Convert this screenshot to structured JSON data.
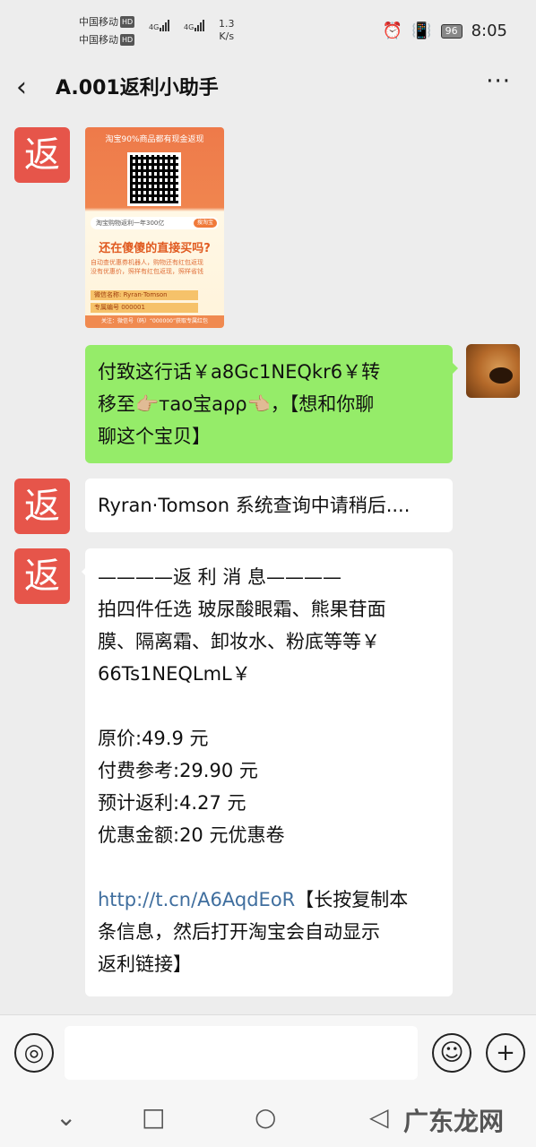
{
  "status_bar": {
    "carrier1": "中国移动",
    "carrier2": "中国移动",
    "hd": "HD",
    "net": "4G",
    "speed_value": "1.3",
    "speed_unit": "K/s",
    "battery": "96",
    "time": "8:05"
  },
  "header": {
    "title": "A.001返利小助手",
    "back_icon": "chevron-left-icon",
    "more": "···"
  },
  "poster": {
    "top": "淘宝90%商品都有现金返现",
    "search": "淘宝购物返利一年300亿",
    "search_btn": "搜淘宝",
    "question": "还在傻傻的直接买吗?",
    "line1": "自动查优惠券机器人，购物还有红包返现",
    "line2": "没有优惠价，照样有红包返现，照样省钱",
    "wechat": "微信名称: Ryran·Tomson",
    "code": "专属编号 000001",
    "footer": "关注：微信号（码）“000000”获取专属红包"
  },
  "messages": {
    "m1_line1": "付致这行话￥a8Gc1NEQkr6￥转",
    "m1_line2": "移至👉🏼тao宝аρρ👈🏼，【想和你聊",
    "m1_line3": "聊这个宝贝】",
    "m2": "Ryran·Tomson 系统查询中请稍后....",
    "m3_header": "————返 利 消 息————",
    "m3_desc1": "拍四件任选 玻尿酸眼霜、熊果苷面",
    "m3_desc2": "膜、隔离霜、卸妆水、粉底等等￥",
    "m3_desc3": "66Ts1NEQLmL￥",
    "m3_price": "原价:49.9 元",
    "m3_pay": "付费参考:29.90 元",
    "m3_rebate": "预计返利:4.27 元",
    "m3_coupon": "优惠金额:20 元优惠卷",
    "m3_link": "http://t.cn/A6AqdEoR",
    "m3_after1": "【长按复制本",
    "m3_after2": "条信息，然后打开淘宝会自动显示",
    "m3_after3": "返利链接】"
  },
  "avatars": {
    "bot_char": "返"
  },
  "input": {
    "placeholder": ""
  },
  "watermark": "广东龙网"
}
